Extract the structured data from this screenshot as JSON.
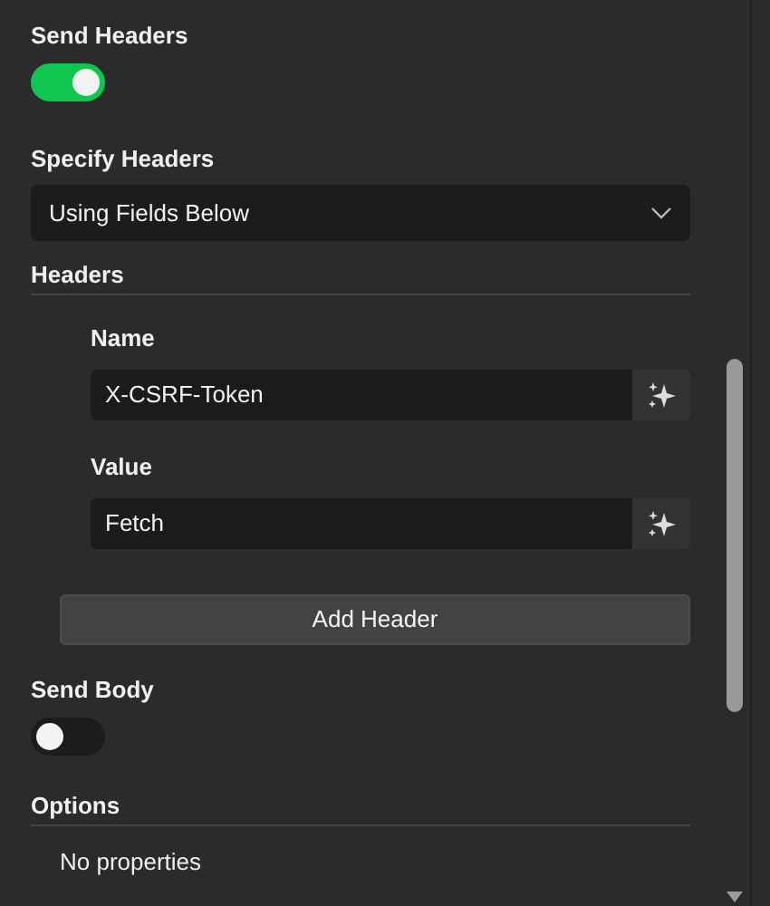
{
  "send_headers": {
    "label": "Send Headers",
    "on": true
  },
  "specify_headers": {
    "label": "Specify Headers",
    "value": "Using Fields Below"
  },
  "headers": {
    "title": "Headers",
    "fields": [
      {
        "label": "Name",
        "value": "X-CSRF-Token"
      },
      {
        "label": "Value",
        "value": "Fetch"
      }
    ],
    "add_button": "Add Header"
  },
  "send_body": {
    "label": "Send Body",
    "on": false
  },
  "options": {
    "title": "Options",
    "empty_text": "No properties"
  }
}
